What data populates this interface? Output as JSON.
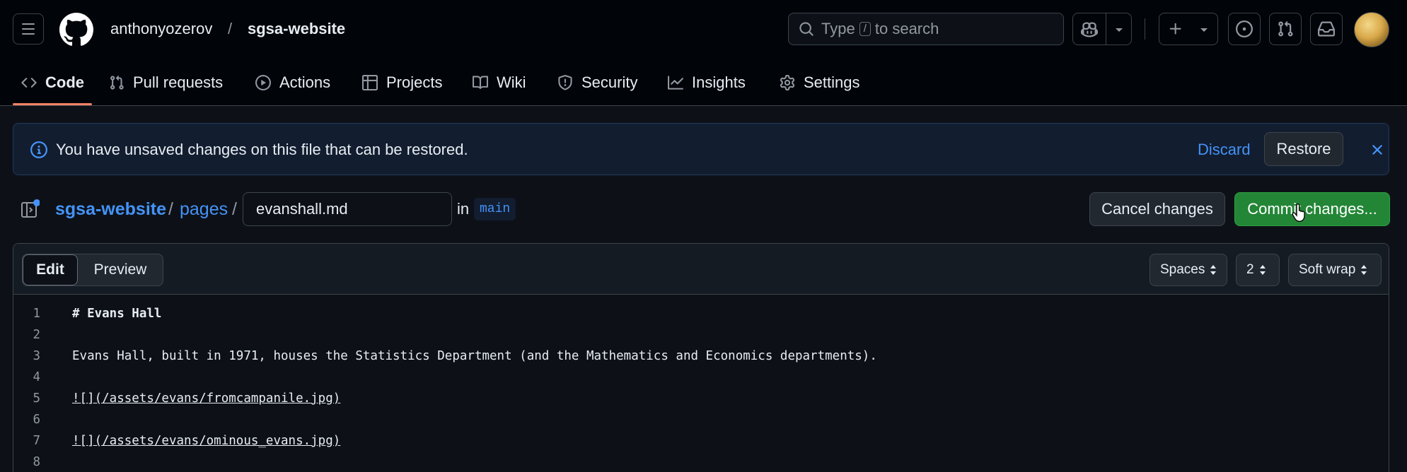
{
  "header": {
    "owner": "anthonyozerov",
    "separator": "/",
    "repo": "sgsa-website",
    "search": {
      "prefix": "Type",
      "key": "/",
      "suffix": "to search"
    }
  },
  "nav": {
    "tabs": [
      {
        "label": "Code",
        "icon": "code-icon",
        "active": true
      },
      {
        "label": "Pull requests",
        "icon": "git-pull-request-icon"
      },
      {
        "label": "Actions",
        "icon": "play-icon"
      },
      {
        "label": "Projects",
        "icon": "table-icon"
      },
      {
        "label": "Wiki",
        "icon": "book-icon"
      },
      {
        "label": "Security",
        "icon": "shield-icon"
      },
      {
        "label": "Insights",
        "icon": "graph-icon"
      },
      {
        "label": "Settings",
        "icon": "gear-icon"
      }
    ]
  },
  "banner": {
    "message": "You have unsaved changes on this file that can be restored.",
    "discard": "Discard",
    "restore": "Restore"
  },
  "filepath": {
    "repo": "sgsa-website",
    "sep": "/",
    "folder": "pages",
    "filename": "evanshall.md",
    "in_label": "in",
    "branch": "main",
    "cancel": "Cancel changes",
    "commit": "Commit changes..."
  },
  "editor": {
    "mode_edit": "Edit",
    "mode_preview": "Preview",
    "indent_mode": "Spaces",
    "indent_size": "2",
    "wrap_mode": "Soft wrap",
    "lines": [
      {
        "n": "1",
        "text": "# Evans Hall",
        "kind": "heading"
      },
      {
        "n": "2",
        "text": "",
        "kind": "plain"
      },
      {
        "n": "3",
        "text": "Evans Hall, built in 1971, houses the Statistics Department (and the Mathematics and Economics departments).",
        "kind": "plain"
      },
      {
        "n": "4",
        "text": "",
        "kind": "plain"
      },
      {
        "n": "5",
        "text": "![](/assets/evans/fromcampanile.jpg)",
        "kind": "link"
      },
      {
        "n": "6",
        "text": "",
        "kind": "plain"
      },
      {
        "n": "7",
        "text": "![](/assets/evans/ominous_evans.jpg)",
        "kind": "link"
      },
      {
        "n": "8",
        "text": "",
        "kind": "plain"
      }
    ]
  },
  "colors": {
    "accent": "#4493f8",
    "primary_button": "#238636",
    "tab_underline": "#f78166",
    "banner_bg": "#121d2f"
  }
}
